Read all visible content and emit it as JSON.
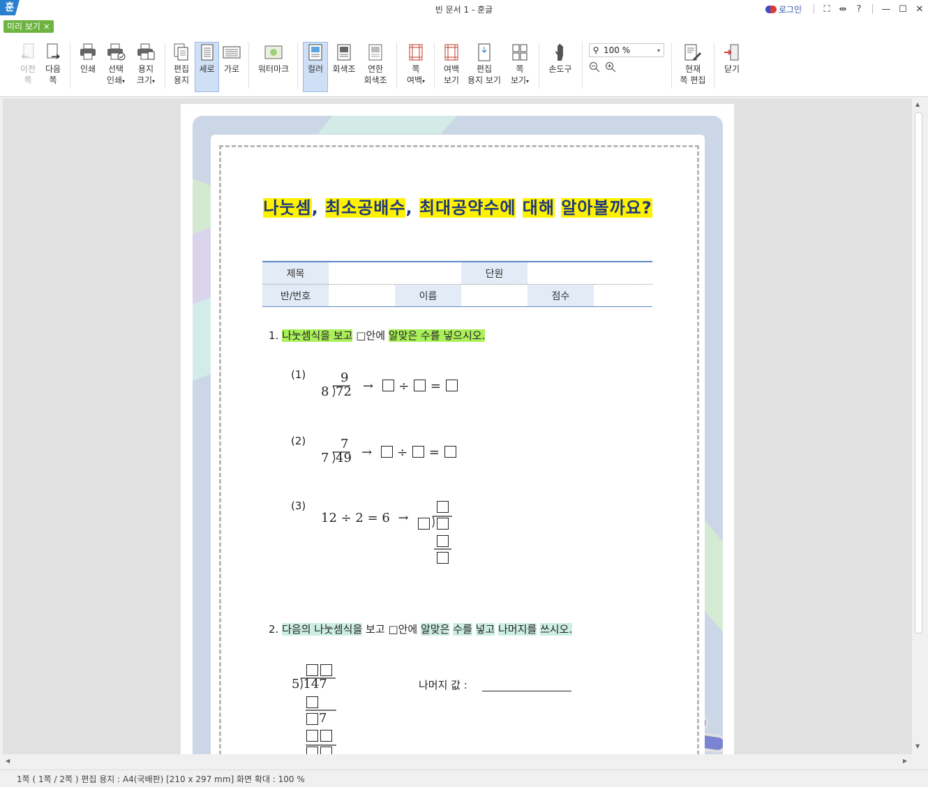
{
  "window": {
    "icon": "훈",
    "title": "빈 문서 1 - 훈글",
    "login": "로그인",
    "help": "?"
  },
  "tab": {
    "label": "미리 보기 ×"
  },
  "toolbar": {
    "prev": [
      "이전",
      "쪽"
    ],
    "next": [
      "다음",
      "쪽"
    ],
    "print": [
      "인쇄"
    ],
    "select_print": [
      "선택",
      "인쇄"
    ],
    "paper_size": [
      "용지",
      "크기"
    ],
    "edit_paper": [
      "편집",
      "용지"
    ],
    "portrait": [
      "세로"
    ],
    "landscape": [
      "가로"
    ],
    "watermark": [
      "워터마크"
    ],
    "color": [
      "컬러"
    ],
    "grayscale": [
      "회색조"
    ],
    "light_gray": [
      "연한",
      "회색조"
    ],
    "margin": [
      "쪽",
      "여백"
    ],
    "margin_view": [
      "여백",
      "보기"
    ],
    "paper_view": [
      "편집",
      "용지 보기"
    ],
    "page_view": [
      "쪽",
      "보기"
    ],
    "hand": [
      "손도구"
    ],
    "zoom_value": "100 %",
    "current_edit": [
      "현재",
      "쪽 편집"
    ],
    "close": [
      "닫기"
    ]
  },
  "document": {
    "title_parts": [
      "나눗셈",
      ", ",
      "최소공배수",
      ", ",
      "최대공약수에",
      " ",
      "대해",
      " ",
      "알아볼까요?"
    ],
    "table": {
      "title_label": "제목",
      "unit_label": "단원",
      "class_label": "반/번호",
      "name_label": "이름",
      "score_label": "점수"
    },
    "q1": {
      "num": "1.",
      "p1": "나눗셈식을 보고",
      "p2": "□안에",
      "p3": "알맞은 수를 넣으시오."
    },
    "items": [
      {
        "label": "(1)",
        "quotient": "9",
        "divisor": "8",
        "dividend": "72"
      },
      {
        "label": "(2)",
        "quotient": "7",
        "divisor": "7",
        "dividend": "49"
      },
      {
        "label": "(3)",
        "equation": "12 ÷ 2 = 6"
      }
    ],
    "arrow": "→",
    "div_sign": "÷",
    "eq_sign": "=",
    "q2": {
      "num": "2.",
      "p1": "다음의 나눗셈식을",
      "p2": "보고",
      "p3": "□안에",
      "p4": "알맞은",
      "p5": "수를",
      "p6": "넣고",
      "p7": "나머지를",
      "p8": "쓰시오."
    },
    "q2_divisor": "5",
    "q2_dividend": "147",
    "q2_digit": "7",
    "remainder_label": "나머지 값 :"
  },
  "status": "1쪽 ( 1쪽 / 2쪽 ) 편집 용지 : A4(국배판)  [210 x 297 mm]  화면 확대 : 100 %"
}
